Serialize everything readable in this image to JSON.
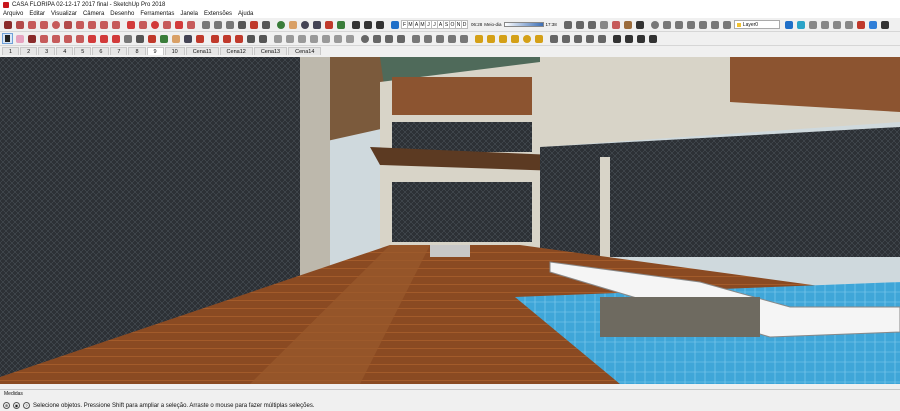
{
  "window": {
    "title": "CASA FLORIPA 02-12-17 2017 final - SketchUp Pro 2018"
  },
  "menu": [
    "Arquivo",
    "Editar",
    "Visualizar",
    "Câmera",
    "Desenho",
    "Ferramentas",
    "Janela",
    "Extensões",
    "Ajuda"
  ],
  "toolbar": {
    "style_letters": [
      "F",
      "M",
      "A",
      "M",
      "J",
      "J",
      "A",
      "S",
      "O",
      "N",
      "D"
    ],
    "time_left": "06:28",
    "time_mid": "Meio-dia",
    "time_right": "17:38",
    "layer": "Layer0"
  },
  "scenes": [
    "1",
    "2",
    "3",
    "4",
    "5",
    "6",
    "7",
    "8",
    "9",
    "10",
    "Cena11",
    "Cena12",
    "Cena13",
    "Cena14"
  ],
  "active_scene_index": 8,
  "measures": {
    "label": "Medidas"
  },
  "status": {
    "message": "Selecione objetos. Pressione Shift para ampliar a seleção. Arraste o mouse para fazer múltiplas seleções."
  },
  "colors": {
    "accent": "#c8161d",
    "wood": "#8a4a22",
    "pool": "#3fa6d8"
  }
}
